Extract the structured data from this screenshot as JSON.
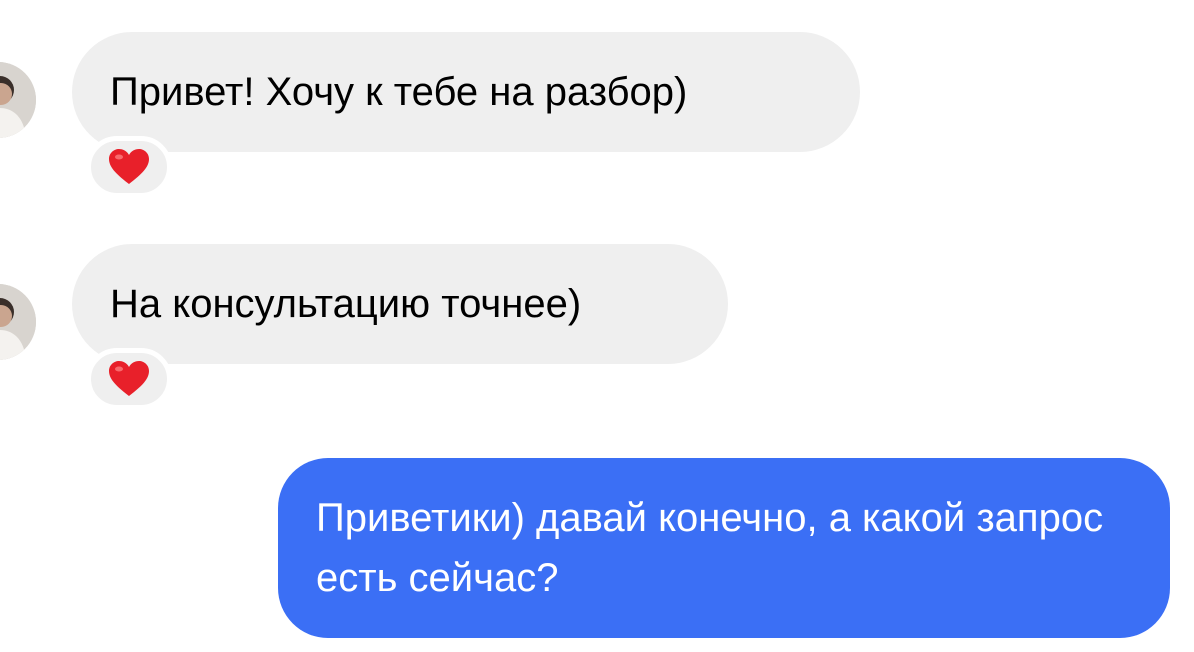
{
  "messages": [
    {
      "direction": "incoming",
      "text": "Привет! Хочу к тебе на разбор)",
      "reaction": "heart-icon"
    },
    {
      "direction": "incoming",
      "text": "На консультацию точнее)",
      "reaction": "heart-icon"
    },
    {
      "direction": "outgoing",
      "text": "Приветики) давай конечно, а какой запрос есть сейчас?"
    }
  ],
  "colors": {
    "incoming_bubble": "#efefef",
    "outgoing_bubble": "#3b6ff5",
    "reaction_heart": "#e8202a"
  }
}
